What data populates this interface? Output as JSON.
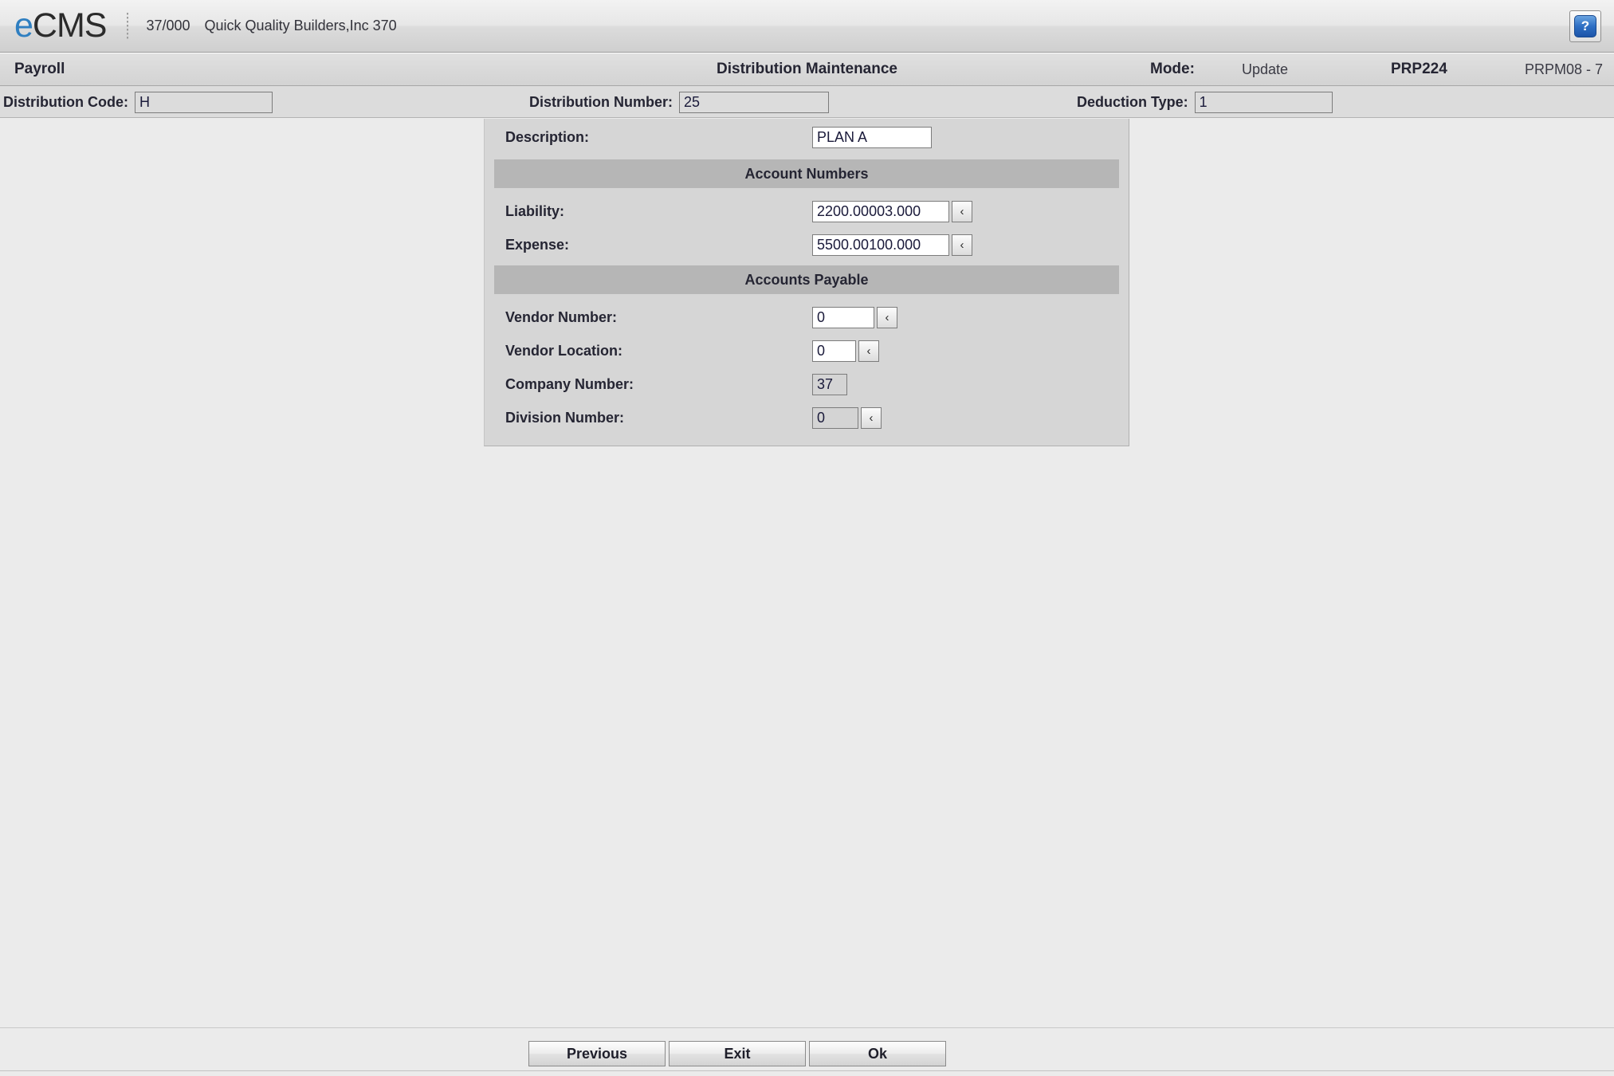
{
  "brand": {
    "logo_e": "e",
    "logo_cms": "CMS",
    "company_number": "37/000",
    "company_name": "Quick Quality Builders,Inc 370",
    "help_icon": "help-question-icon",
    "help_glyph": "?"
  },
  "titlebar": {
    "module": "Payroll",
    "title": "Distribution Maintenance",
    "mode_label": "Mode:",
    "mode_value": "Update",
    "program_id": "PRP224",
    "screen_id": "PRPM08 - 7"
  },
  "keyfields": {
    "distribution_code_label": "Distribution Code:",
    "distribution_code_value": "H",
    "distribution_number_label": "Distribution Number:",
    "distribution_number_value": "25",
    "deduction_type_label": "Deduction Type:",
    "deduction_type_value": "1"
  },
  "form": {
    "description_label": "Description:",
    "description_value": "PLAN A",
    "account_numbers_header": "Account Numbers",
    "liability_label": "Liability:",
    "liability_value": "2200.00003.000",
    "expense_label": "Expense:",
    "expense_value": "5500.00100.000",
    "accounts_payable_header": "Accounts Payable",
    "vendor_number_label": "Vendor Number:",
    "vendor_number_value": "0",
    "vendor_location_label": "Vendor Location:",
    "vendor_location_value": "0",
    "company_number_label": "Company Number:",
    "company_number_value": "37",
    "division_number_label": "Division Number:",
    "division_number_value": "0",
    "lookup_glyph": "‹",
    "lookup_icon": "lookup-chevron-left-icon"
  },
  "footer": {
    "previous_label": "Previous",
    "exit_label": "Exit",
    "ok_label": "Ok"
  },
  "colors": {
    "accent_blue": "#2f7fc1",
    "panel_bg": "#d6d6d6",
    "section_bg": "#b6b6b6",
    "page_bg": "#ebebeb"
  }
}
